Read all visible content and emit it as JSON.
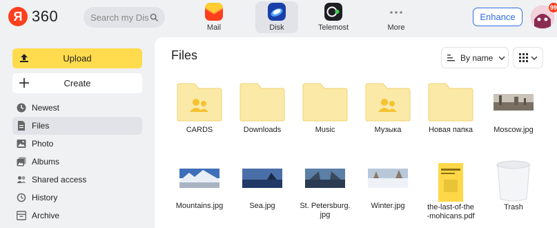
{
  "header": {
    "logo_text": "360",
    "search_placeholder": "Search my Disk",
    "apps": [
      {
        "label": "Mail",
        "icon": "mail-icon"
      },
      {
        "label": "Disk",
        "icon": "disk-icon"
      },
      {
        "label": "Telemost",
        "icon": "telemost-icon"
      },
      {
        "label": "More",
        "icon": "more-icon"
      }
    ],
    "enhance_label": "Enhance",
    "avatar_badge": "99"
  },
  "sidebar": {
    "upload_label": "Upload",
    "create_label": "Create",
    "items": [
      {
        "label": "Newest",
        "icon": "clock-icon"
      },
      {
        "label": "Files",
        "icon": "file-icon"
      },
      {
        "label": "Photo",
        "icon": "photo-icon"
      },
      {
        "label": "Albums",
        "icon": "albums-icon"
      },
      {
        "label": "Shared access",
        "icon": "shared-icon"
      },
      {
        "label": "History",
        "icon": "history-icon"
      },
      {
        "label": "Archive",
        "icon": "archive-icon"
      }
    ]
  },
  "main": {
    "title": "Files",
    "sort_label": "By name",
    "files": [
      {
        "name": "CARDS",
        "type": "shared-folder"
      },
      {
        "name": "Downloads",
        "type": "folder"
      },
      {
        "name": "Music",
        "type": "folder"
      },
      {
        "name": "Музыка",
        "type": "shared-folder"
      },
      {
        "name": "Новая папка",
        "type": "folder"
      },
      {
        "name": "Moscow.jpg",
        "type": "image"
      },
      {
        "name": "Mountains.jpg",
        "type": "image"
      },
      {
        "name": "Sea.jpg",
        "type": "image"
      },
      {
        "name": "St. Petersburg.\njpg",
        "type": "image"
      },
      {
        "name": "Winter.jpg",
        "type": "image"
      },
      {
        "name": "the-last-of-the\n-mohicans.pdf",
        "type": "pdf"
      },
      {
        "name": "Trash",
        "type": "trash"
      }
    ]
  },
  "colors": {
    "accent_yellow": "#ffdb4d",
    "accent_blue": "#2f6de5",
    "folder_fill": "#fbe9a7",
    "brand_red": "#fc3f1d"
  }
}
